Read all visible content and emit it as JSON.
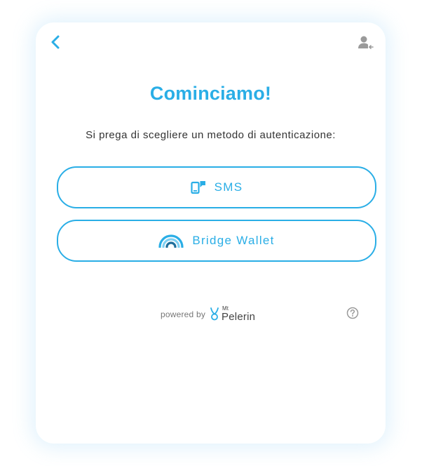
{
  "header": {
    "back_icon": "chevron-left-icon",
    "user_icon": "user-switch-icon"
  },
  "title": "Cominciamo!",
  "subtitle": "Si prega di scegliere un metodo di autenticazione:",
  "auth_options": [
    {
      "label": "SMS",
      "icon": "phone-message-icon"
    },
    {
      "label": "Bridge Wallet",
      "icon": "bridge-wallet-icon"
    }
  ],
  "footer": {
    "powered_by": "powered by",
    "brand_small": "Mt",
    "brand_name": "Pelerin",
    "help_icon": "question-circle-icon"
  },
  "colors": {
    "accent": "#2aaee6",
    "text": "#333333",
    "muted": "#777777",
    "icon_gray": "#9a9a9a"
  }
}
